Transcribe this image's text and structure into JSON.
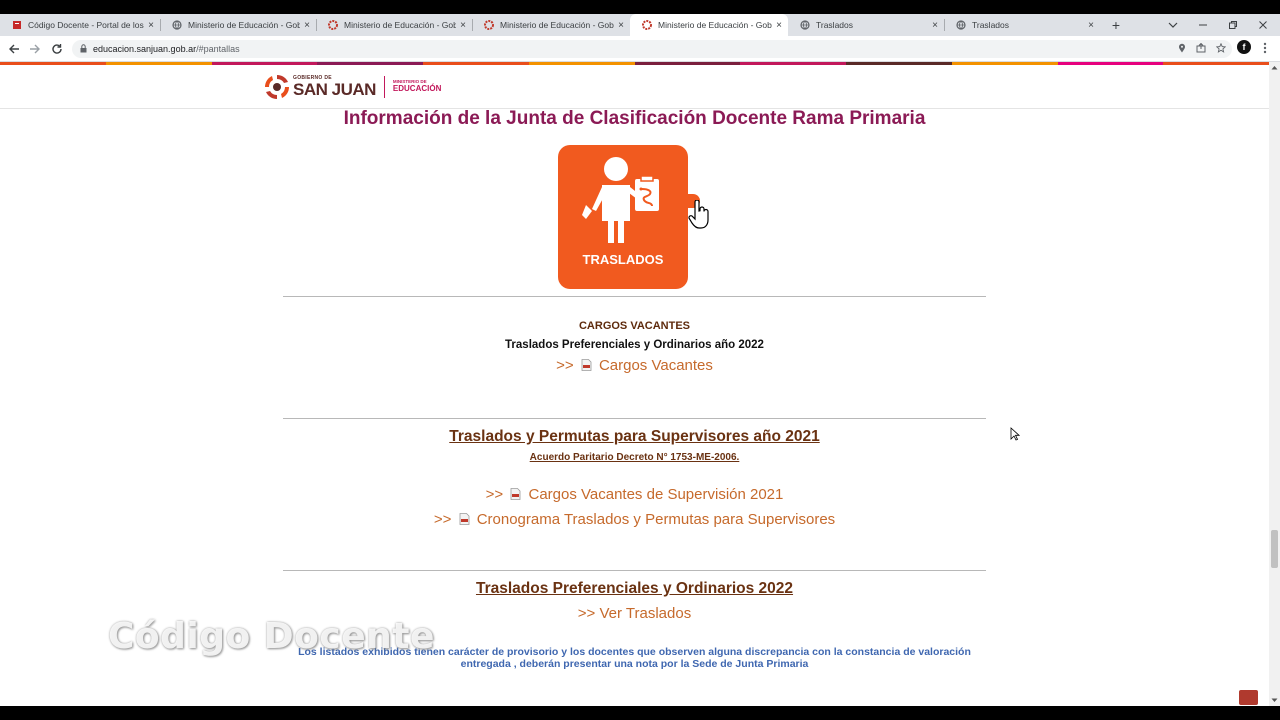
{
  "browser": {
    "tabs": [
      {
        "title": "Código Docente - Portal de los D",
        "favicon": "red-book-icon",
        "active": false
      },
      {
        "title": "Ministerio de Educación - Gobie",
        "favicon": "globe-icon",
        "active": false
      },
      {
        "title": "Ministerio de Educación - Gobie",
        "favicon": "sanjuan-sun-icon",
        "active": false
      },
      {
        "title": "Ministerio de Educación - Gobie",
        "favicon": "sanjuan-sun-icon",
        "active": false
      },
      {
        "title": "Ministerio de Educación - Gobie",
        "favicon": "sanjuan-sun-icon",
        "active": true
      },
      {
        "title": "Traslados",
        "favicon": "globe-icon",
        "active": false
      },
      {
        "title": "Traslados",
        "favicon": "globe-icon",
        "active": false
      }
    ],
    "close_glyph": "×",
    "new_tab_glyph": "+",
    "url_host": "educacion.sanjuan.gob.ar",
    "url_path": "/#pantallas",
    "profile_initial": "f"
  },
  "header": {
    "logo_small": "GOBIERNO DE",
    "logo_big": "SAN JUAN",
    "ministry_small": "MINISTERIO DE",
    "ministry_big": "EDUCACIÓN",
    "stripe_colors": [
      "#e94e1b",
      "#f39200",
      "#c2185b",
      "#8b1a55",
      "#e94e1b",
      "#f39200",
      "#7a1f3d",
      "#c2185b",
      "#5a2a27",
      "#f39200",
      "#e6007e",
      "#e94e1b"
    ]
  },
  "page": {
    "title": "Información de la Junta de Clasificación Docente Rama Primaria",
    "tile_label": "TRASLADOS",
    "tile_color": "#f15a1f"
  },
  "section1": {
    "heading": "CARGOS VACANTES",
    "subheading": "Traslados Preferenciales y Ordinarios año 2022",
    "link": {
      "prefix": ">>",
      "label": "Cargos Vacantes"
    }
  },
  "section2": {
    "heading": "Traslados y Permutas para Supervisores año 2021",
    "subheading": "Acuerdo Paritario Decreto N° 1753-ME-2006.",
    "links": [
      {
        "prefix": ">>",
        "label": "Cargos Vacantes de Supervisión 2021"
      },
      {
        "prefix": ">>",
        "label": "Cronograma Traslados y Permutas para Supervisores"
      }
    ]
  },
  "section3": {
    "heading": "Traslados Preferenciales y Ordinarios 2022",
    "link": {
      "prefix": ">>",
      "label": "Ver Traslados"
    }
  },
  "notice": {
    "line1": "Los listados exhibidos tienen carácter de provisorio y los docentes que observen  alguna discrepancia con la constancia de valoración",
    "line2": "entregada , deberán presentar una nota por la Sede de Junta Primaria"
  },
  "watermark": "Código Docente"
}
